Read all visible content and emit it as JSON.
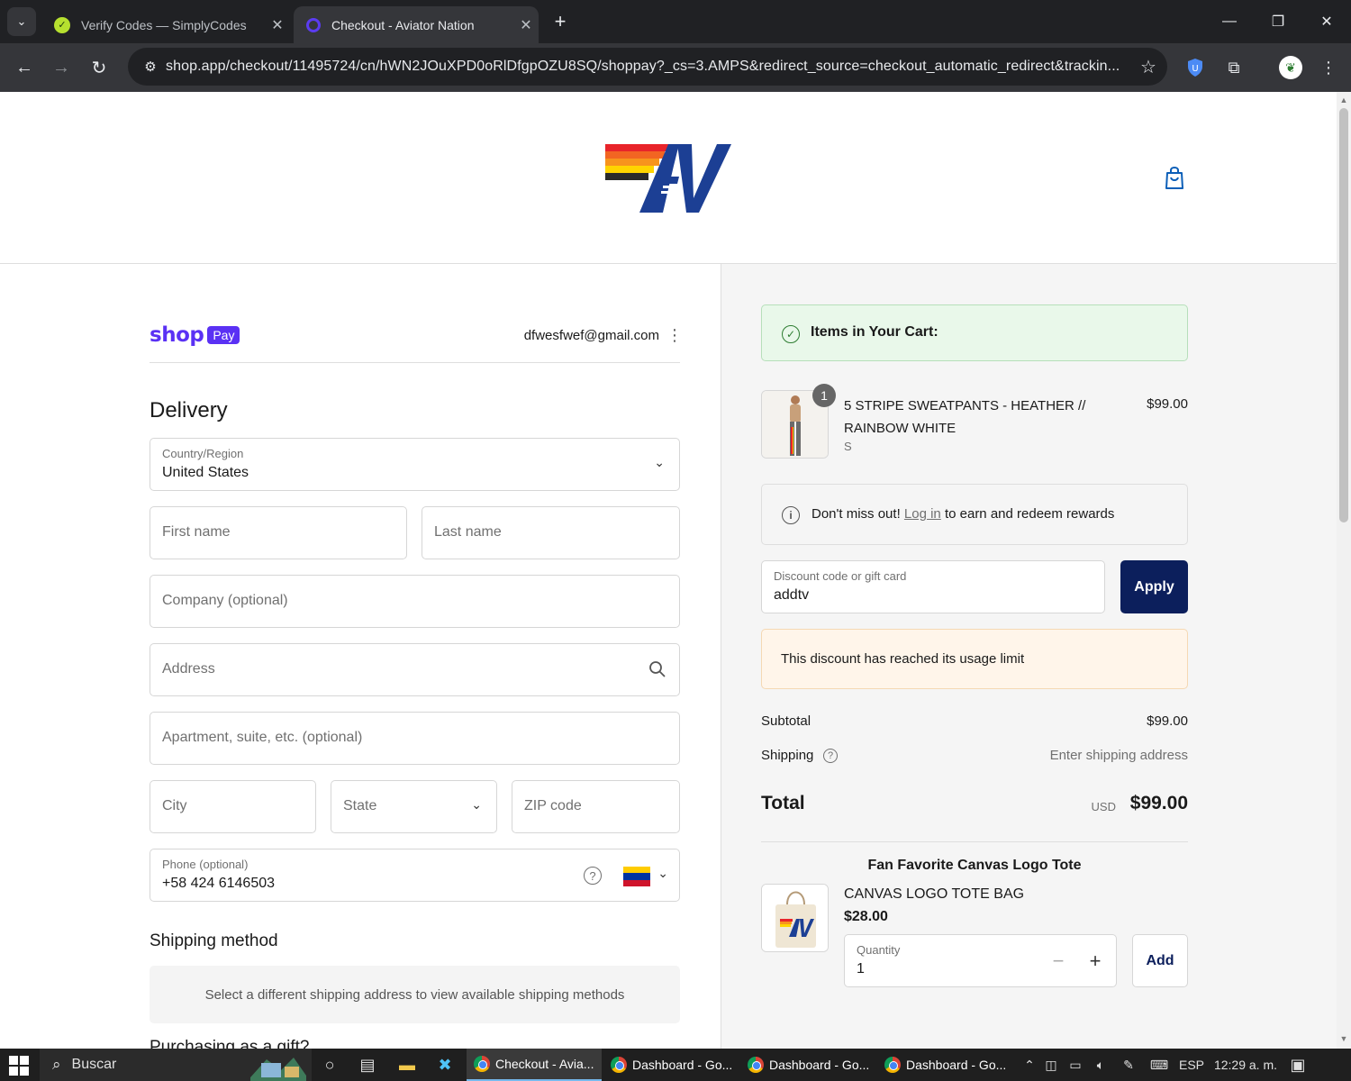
{
  "browser": {
    "tabs": [
      {
        "title": "Verify Codes — SimplyCodes",
        "active": false
      },
      {
        "title": "Checkout - Aviator Nation",
        "active": true
      }
    ],
    "url": "shop.app/checkout/11495724/cn/hWN2JOuXPD0oRlDfgpOZU8SQ/shoppay?_cs=3.AMPS&redirect_source=checkout_automatic_redirect&trackin..."
  },
  "header": {
    "logo_alt": "AV",
    "brand_colors": [
      "#e8242a",
      "#f7941d",
      "#ffd400",
      "#1c3f94"
    ]
  },
  "account": {
    "brand_word": "shop",
    "brand_badge": "Pay",
    "email": "dfwesfwef@gmail.com"
  },
  "delivery": {
    "heading": "Delivery",
    "country_label": "Country/Region",
    "country_value": "United States",
    "first_name_placeholder": "First name",
    "last_name_placeholder": "Last name",
    "company_placeholder": "Company (optional)",
    "address_placeholder": "Address",
    "apartment_placeholder": "Apartment, suite, etc. (optional)",
    "city_placeholder": "City",
    "state_placeholder": "State",
    "zip_placeholder": "ZIP code",
    "phone_label": "Phone (optional)",
    "phone_value": "+58 424 6146503"
  },
  "shipping_method": {
    "heading": "Shipping method",
    "message": "Select a different shipping address to view available shipping methods"
  },
  "gift": {
    "heading": "Purchasing as a gift?"
  },
  "cart": {
    "notice": "Items in Your Cart:",
    "items": [
      {
        "title": "5 STRIPE SWEATPANTS - HEATHER // RAINBOW WHITE",
        "variant": "S",
        "price": "$99.00",
        "quantity": "1"
      }
    ],
    "rewards_prefix": "Don't miss out!",
    "rewards_link": "Log in",
    "rewards_suffix": "to earn and redeem rewards",
    "discount_label": "Discount code or gift card",
    "discount_value": "addtv",
    "apply_label": "Apply",
    "discount_error": "This discount has reached its usage limit",
    "subtotal_label": "Subtotal",
    "subtotal_value": "$99.00",
    "shipping_label": "Shipping",
    "shipping_value": "Enter shipping address",
    "total_label": "Total",
    "total_currency": "USD",
    "total_value": "$99.00"
  },
  "upsell": {
    "heading": "Fan Favorite Canvas Logo Tote",
    "name": "CANVAS LOGO TOTE BAG",
    "price": "$28.00",
    "quantity_label": "Quantity",
    "quantity_value": "1",
    "add_label": "Add"
  },
  "taskbar": {
    "search_label": "Buscar",
    "apps": [
      {
        "title": "Checkout - Avia...",
        "active": true
      },
      {
        "title": "Dashboard - Go...",
        "active": false
      },
      {
        "title": "Dashboard - Go...",
        "active": false
      },
      {
        "title": "Dashboard - Go...",
        "active": false
      }
    ],
    "language": "ESP",
    "time": "12:29 a. m."
  }
}
